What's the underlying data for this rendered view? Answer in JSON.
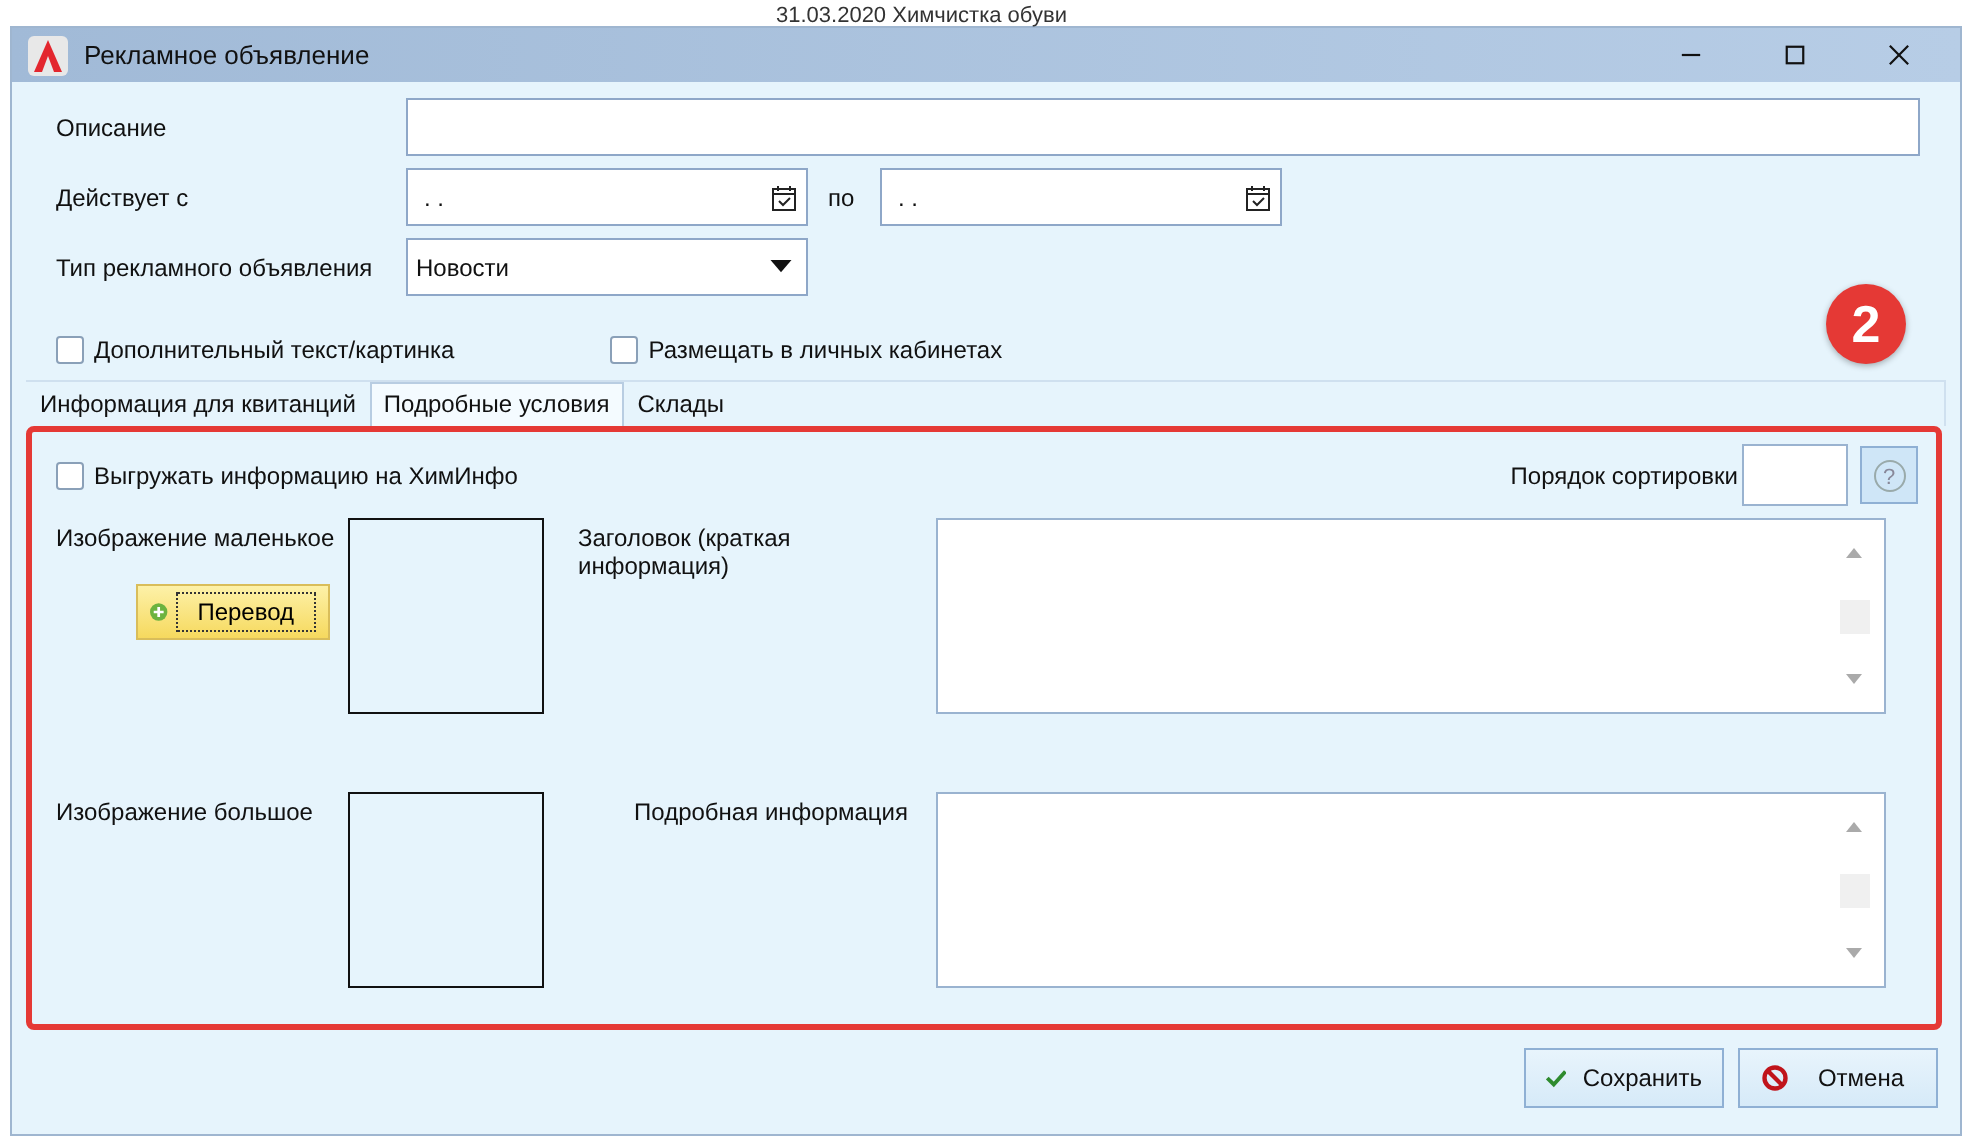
{
  "background_text": "31.03.2020 Химчистка обуви",
  "window": {
    "title": "Рекламное объявление"
  },
  "description": {
    "label": "Описание"
  },
  "valid_from": {
    "label": "Действует с",
    "value": ". ."
  },
  "valid_to": {
    "label": "по",
    "value": ". ."
  },
  "ad_type": {
    "label": "Тип рекламного объявления",
    "value": "Новости"
  },
  "options": [
    {
      "label": "Дополнительный текст/картинка",
      "checked": false
    },
    {
      "label": "Размещать в личных кабинетах",
      "checked": false
    }
  ],
  "annotation_badge": "2",
  "tabs": [
    {
      "label": "Информация для квитанций",
      "selected": false
    },
    {
      "label": "Подробные условия",
      "selected": true
    },
    {
      "label": "Склады",
      "selected": false
    }
  ],
  "panel": {
    "export": {
      "label": "Выгружать информацию на ХимИнфо",
      "checked": false
    },
    "sort_order_label": "Порядок сортировки",
    "help_glyph": "?",
    "small_image_label": "Изображение маленькое",
    "translate_button": "Перевод",
    "headline_label": "Заголовок (краткая информация)",
    "large_image_label": "Изображение большое",
    "details_label": "Подробная информация"
  },
  "buttons": [
    {
      "kind": "save",
      "label": "Сохранить"
    },
    {
      "kind": "cancel",
      "label": "Отмена"
    }
  ]
}
